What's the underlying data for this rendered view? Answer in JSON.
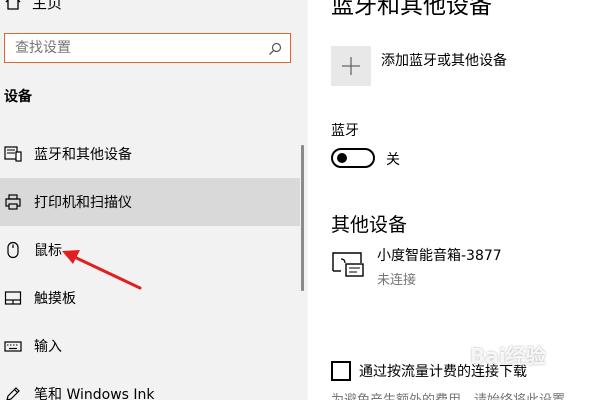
{
  "sidebar": {
    "home_label": "主页",
    "search": {
      "placeholder": "查找设置",
      "value": ""
    },
    "section_heading": "设备",
    "items": [
      {
        "label": "蓝牙和其他设备",
        "icon": "bluetooth-devices-icon"
      },
      {
        "label": "打印机和扫描仪",
        "icon": "printer-icon",
        "hovered": true
      },
      {
        "label": "鼠标",
        "icon": "mouse-icon"
      },
      {
        "label": "触摸板",
        "icon": "touchpad-icon"
      },
      {
        "label": "输入",
        "icon": "keyboard-icon"
      },
      {
        "label": "笔和 Windows Ink",
        "icon": "pen-icon"
      }
    ]
  },
  "main": {
    "title": "蓝牙和其他设备",
    "add_device_label": "添加蓝牙或其他设备",
    "bluetooth": {
      "label": "蓝牙",
      "state": "关"
    },
    "other_devices_heading": "其他设备",
    "devices": [
      {
        "name": "小度智能音箱-3877",
        "status": "未连接",
        "icon": "wireless-display-icon"
      }
    ],
    "metered": {
      "label": "通过按流量计费的连接下载",
      "checked": false
    },
    "note": "为避免产生额外的费用，请始终将此设置"
  },
  "annotation": {
    "color": "#e02020"
  },
  "colors": {
    "sidebar_bg": "#f2f2f2",
    "hover_bg": "#d9d9d9",
    "search_border": "#e06a2e",
    "secondary_text": "#767676"
  }
}
